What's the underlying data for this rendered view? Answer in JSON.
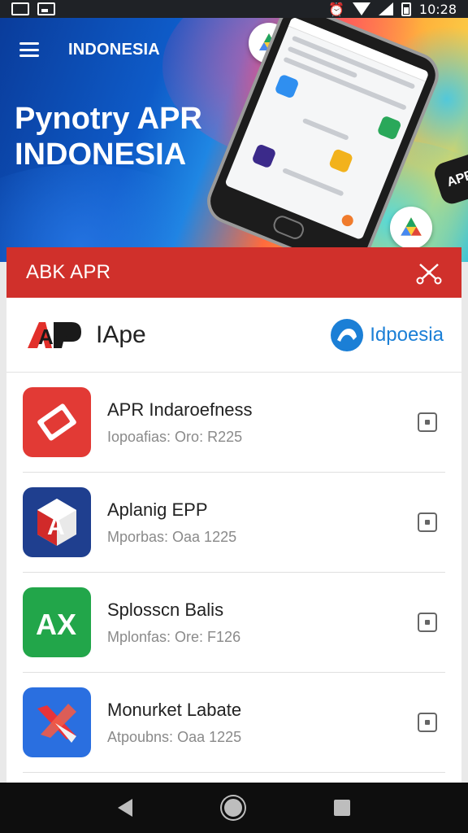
{
  "status_bar": {
    "time": "10:28"
  },
  "hero": {
    "brand": "INDONESIA",
    "title_line1": "Pynotry APR",
    "title_line2": "INDONESIA",
    "dark_badge": "APR"
  },
  "card": {
    "title": "ABK APR",
    "brand_logo_text": "AP",
    "brand_name": "IApe",
    "region_name": "Idpoesia"
  },
  "apps": [
    {
      "name": "APR Indaroefness",
      "meta": "Iopoafias: Oro: R225",
      "color": "#e23a35",
      "icon": "ticket"
    },
    {
      "name": "Aplanig EPP",
      "meta": "Mporbas: Oaa 1225",
      "color": "#1f3f8f",
      "icon": "a-cube"
    },
    {
      "name": "Splosscn Balis",
      "meta": "Mplonfas: Ore: F126",
      "color": "#22a64a",
      "icon": "ax"
    },
    {
      "name": "Monurket Labate",
      "meta": "Atpoubns: Oaa 1225",
      "color": "#2a6fe0",
      "icon": "x-arrow"
    }
  ]
}
